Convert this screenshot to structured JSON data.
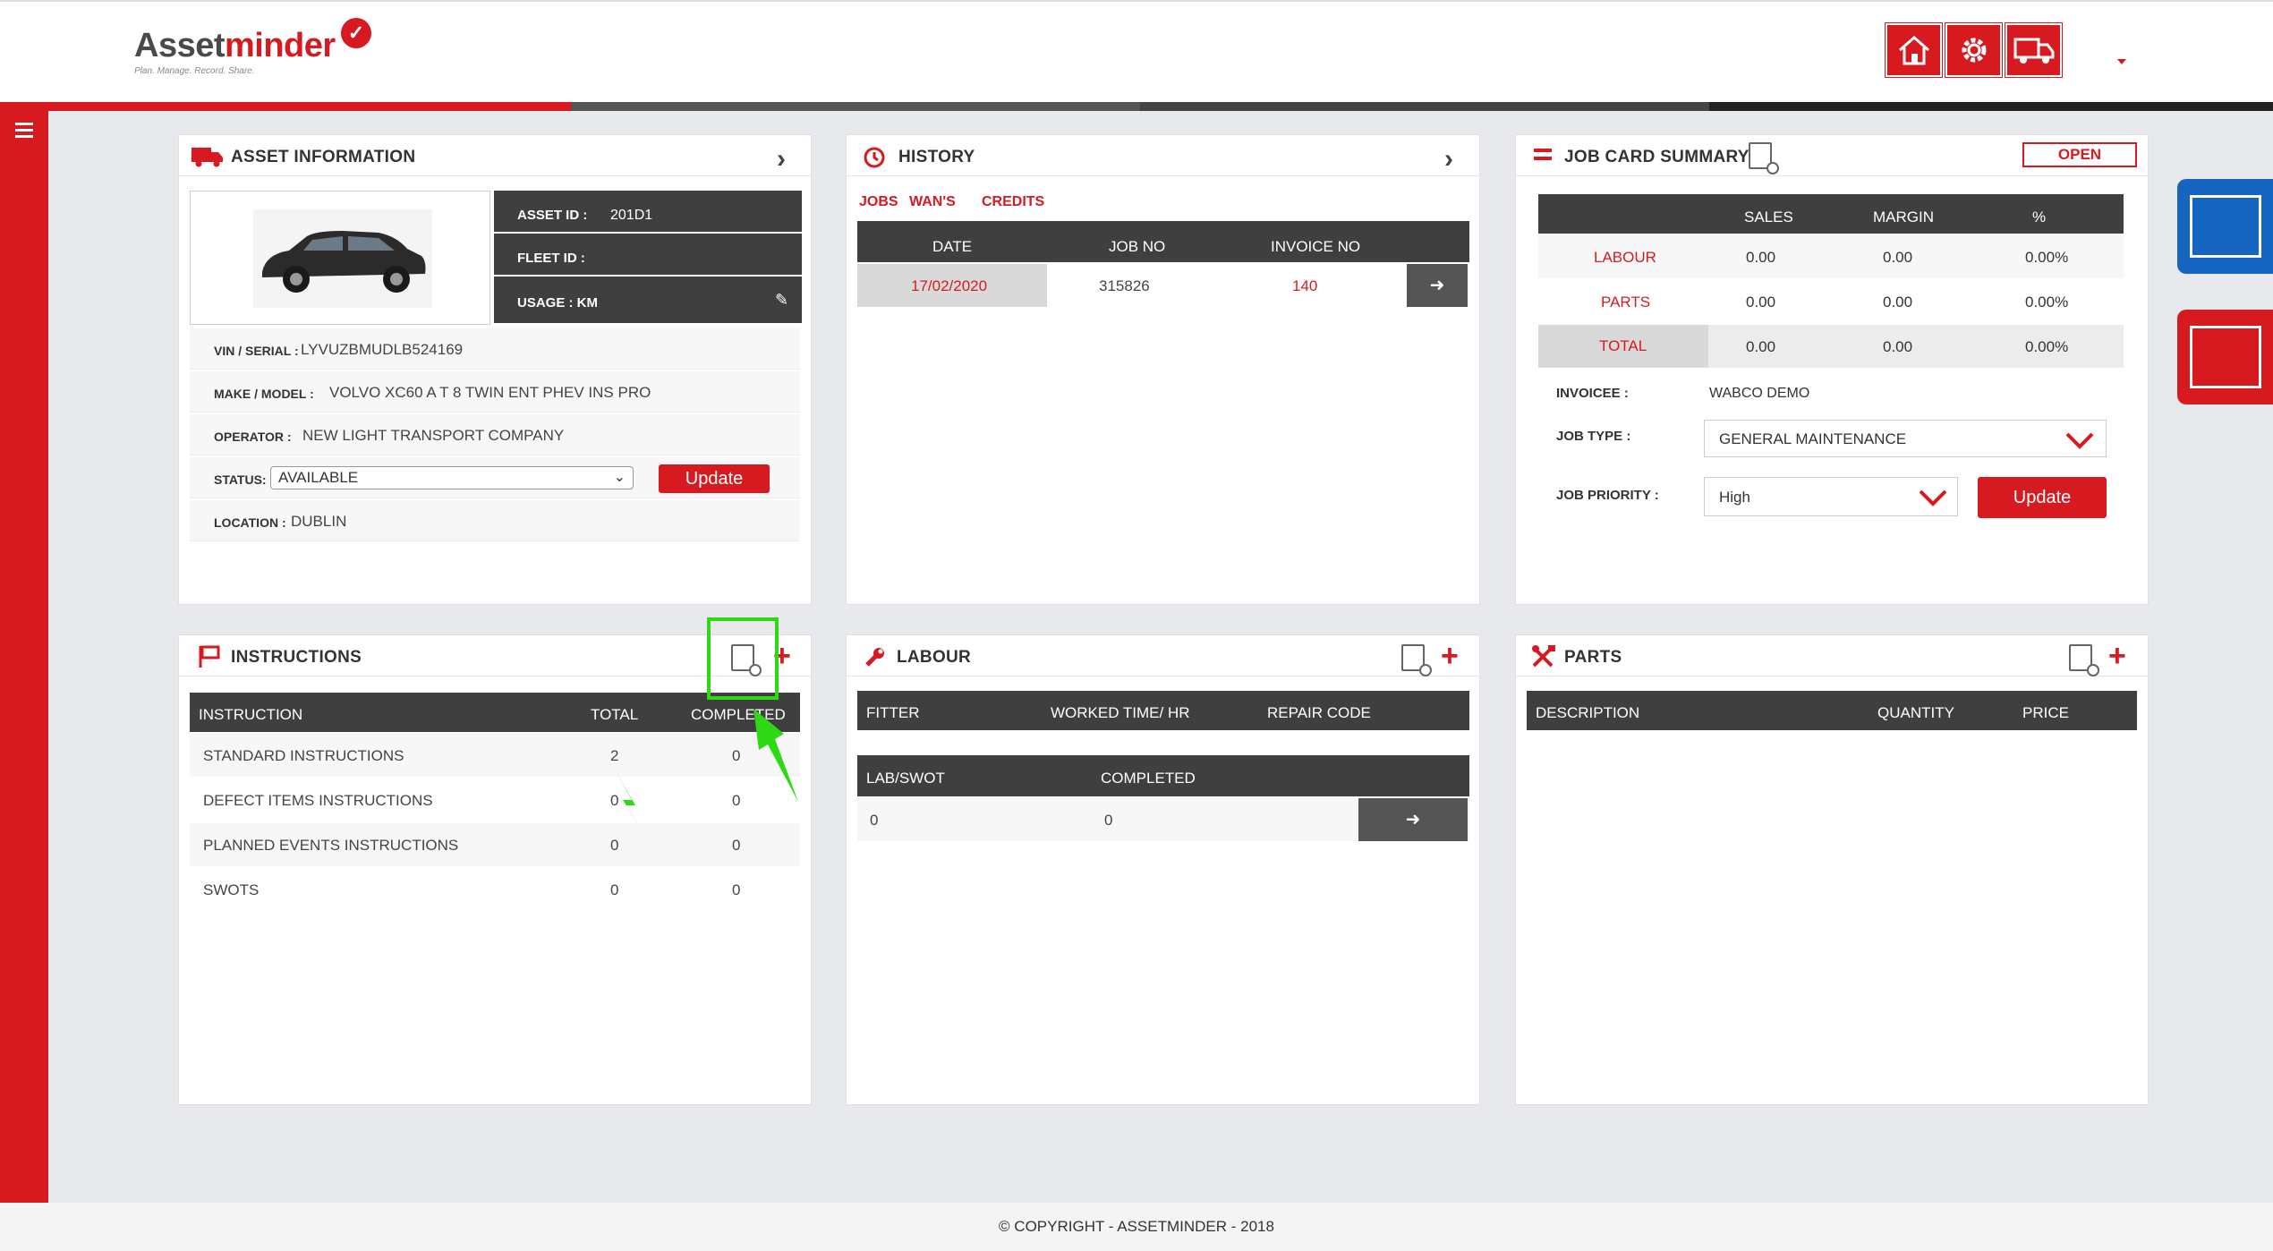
{
  "header": {
    "brand_a": "Asset",
    "brand_b": "minder",
    "tagline": "Plan. Manage. Record. Share.",
    "icons": [
      "home-icon",
      "gear-icon",
      "truck-icon"
    ],
    "accent": "#d71920"
  },
  "asset_info": {
    "title": "ASSET INFORMATION",
    "asset_id_label": "ASSET ID :",
    "asset_id": "201D1",
    "fleet_id_label": "FLEET ID :",
    "fleet_id": "",
    "usage_label": "USAGE : KM",
    "vin_label": "VIN / SERIAL :",
    "vin": "LYVUZBMUDLB524169",
    "make_label": "MAKE / MODEL :",
    "make": "VOLVO XC60 A T 8 TWIN ENT PHEV INS PRO",
    "operator_label": "OPERATOR :",
    "operator": "NEW LIGHT TRANSPORT COMPANY",
    "status_label": "STATUS:",
    "status": "AVAILABLE",
    "update": "Update",
    "location_label": "LOCATION :",
    "location": "DUBLIN"
  },
  "history": {
    "title": "HISTORY",
    "tabs": [
      "JOBS",
      "WAN'S",
      "CREDITS"
    ],
    "columns": [
      "DATE",
      "JOB NO",
      "INVOICE NO"
    ],
    "rows": [
      {
        "date": "17/02/2020",
        "job_no": "315826",
        "invoice_no": "140"
      }
    ]
  },
  "job_card": {
    "title": "JOB CARD SUMMARY",
    "status": "OPEN",
    "columns": [
      "SALES",
      "MARGIN",
      "%"
    ],
    "rows": [
      {
        "label": "LABOUR",
        "sales": "0.00",
        "margin": "0.00",
        "pct": "0.00%"
      },
      {
        "label": "PARTS",
        "sales": "0.00",
        "margin": "0.00",
        "pct": "0.00%"
      },
      {
        "label": "TOTAL",
        "sales": "0.00",
        "margin": "0.00",
        "pct": "0.00%"
      }
    ],
    "invoicee_label": "INVOICEE :",
    "invoicee": "WABCO DEMO",
    "job_type_label": "JOB TYPE :",
    "job_type": "GENERAL MAINTENANCE",
    "priority_label": "JOB PRIORITY :",
    "priority": "High",
    "update": "Update"
  },
  "instructions": {
    "title": "INSTRUCTIONS",
    "columns": [
      "INSTRUCTION",
      "TOTAL",
      "COMPLETED"
    ],
    "rows": [
      {
        "name": "STANDARD INSTRUCTIONS",
        "total": "2",
        "completed": "0"
      },
      {
        "name": "DEFECT ITEMS INSTRUCTIONS",
        "total": "0",
        "completed": "0"
      },
      {
        "name": "PLANNED EVENTS INSTRUCTIONS",
        "total": "0",
        "completed": "0"
      },
      {
        "name": "SWOTS",
        "total": "0",
        "completed": "0"
      }
    ]
  },
  "labour": {
    "title": "LABOUR",
    "columns": [
      "FITTER",
      "WORKED TIME/ HR",
      "REPAIR CODE"
    ],
    "columns2": [
      "LAB/SWOT",
      "COMPLETED"
    ],
    "row": {
      "lab": "0",
      "completed": "0"
    }
  },
  "parts": {
    "title": "PARTS",
    "columns": [
      "DESCRIPTION",
      "QUANTITY",
      "PRICE"
    ]
  },
  "footer": {
    "text": "© COPYRIGHT - ASSETMINDER - 2018"
  }
}
